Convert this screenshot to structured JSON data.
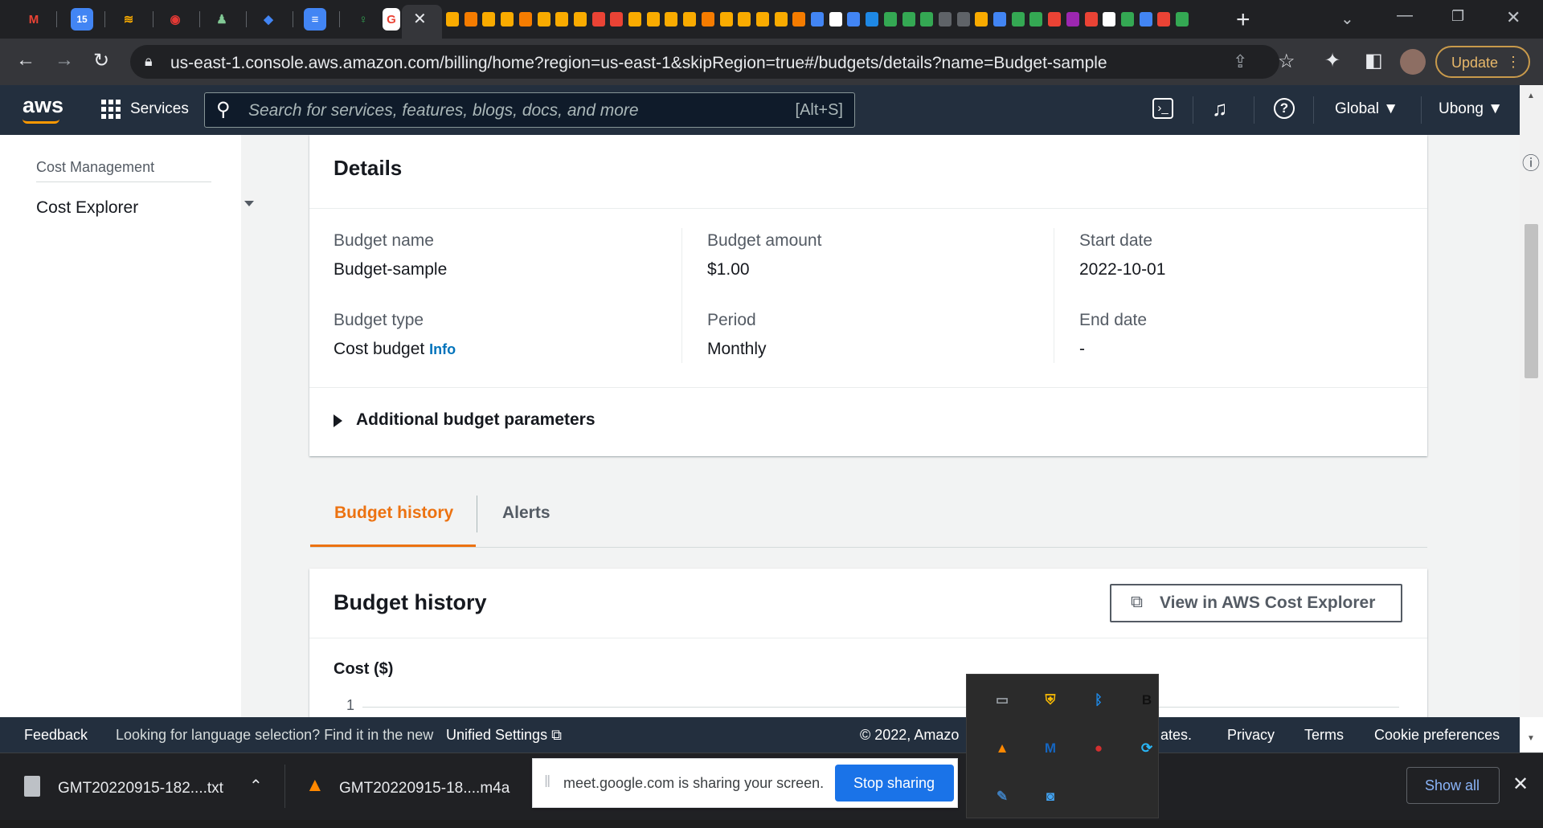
{
  "browser": {
    "pinned_tabs": [
      {
        "name": "gmail",
        "glyph": "M",
        "color": "#ea4335"
      },
      {
        "name": "calendar",
        "glyph": "15",
        "color": "#4285f4"
      },
      {
        "name": "app-three",
        "glyph": "≋",
        "color": "#f9ab00"
      },
      {
        "name": "app-four",
        "glyph": "◉",
        "color": "#e53935"
      },
      {
        "name": "app-five",
        "glyph": "♟",
        "color": "#81c995"
      },
      {
        "name": "app-six",
        "glyph": "◆",
        "color": "#4285f4"
      },
      {
        "name": "docs",
        "glyph": "≡",
        "color": "#4285f4"
      },
      {
        "name": "app-eight",
        "glyph": "♀",
        "color": "#34a853"
      },
      {
        "name": "google",
        "glyph": "G",
        "color": "#ea4335"
      }
    ],
    "url": "us-east-1.console.aws.amazon.com/billing/home?region=us-east-1&skipRegion=true#/budgets/details?name=Budget-sample",
    "update_label": "Update"
  },
  "aws_nav": {
    "logo": "aws",
    "services_label": "Services",
    "search_placeholder": "Search for services, features, blogs, docs, and more",
    "search_shortcut": "[Alt+S]",
    "region": "Global ▼",
    "user": "Ubong ▼"
  },
  "sidebar": {
    "section": "Cost Management",
    "item": "Cost Explorer"
  },
  "details": {
    "title": "Details",
    "fields": {
      "budget_name_label": "Budget name",
      "budget_name": "Budget-sample",
      "budget_amount_label": "Budget amount",
      "budget_amount": "$1.00",
      "start_date_label": "Start date",
      "start_date": "2022-10-01",
      "budget_type_label": "Budget type",
      "budget_type": "Cost budget",
      "info_link": "Info",
      "period_label": "Period",
      "period": "Monthly",
      "end_date_label": "End date",
      "end_date": "-"
    },
    "expander": "Additional budget parameters"
  },
  "tabs": {
    "history": "Budget history",
    "alerts": "Alerts"
  },
  "history_card": {
    "title": "Budget history",
    "cost_explorer_button": "View in AWS Cost Explorer",
    "chart_ylabel": "Cost ($)",
    "y_tick": "1"
  },
  "footer": {
    "feedback": "Feedback",
    "language_text": "Looking for language selection? Find it in the new",
    "unified_settings": "Unified Settings",
    "copyright": "© 2022, Amazo",
    "copyright_tail": "ates.",
    "privacy": "Privacy",
    "terms": "Terms",
    "cookies": "Cookie preferences"
  },
  "downloads": {
    "file1": "GMT20220915-182....txt",
    "file2": "GMT20220915-18....m4a",
    "show_all": "Show all"
  },
  "screen_share": {
    "message": "meet.google.com is sharing your screen.",
    "stop": "Stop sharing"
  },
  "tray_icons": [
    {
      "name": "display-icon",
      "glyph": "▭",
      "color": "#9aa0a6"
    },
    {
      "name": "security-shield-icon",
      "glyph": "⛨",
      "color": "#fbbc04"
    },
    {
      "name": "bluetooth-icon",
      "glyph": "ᛒ",
      "color": "#1e88e5"
    },
    {
      "name": "b-app-icon",
      "glyph": "B",
      "color": "#111111"
    },
    {
      "name": "vlc-icon",
      "glyph": "▲",
      "color": "#ff8800"
    },
    {
      "name": "malwarebytes-icon",
      "glyph": "M",
      "color": "#1565c0"
    },
    {
      "name": "recorder-icon",
      "glyph": "●",
      "color": "#d32f2f"
    },
    {
      "name": "sync-icon",
      "glyph": "⟳",
      "color": "#29b6f6"
    },
    {
      "name": "wrench-icon",
      "glyph": "✎",
      "color": "#3f7fbf"
    },
    {
      "name": "camera-icon",
      "glyph": "◙",
      "color": "#42a5f5"
    }
  ]
}
